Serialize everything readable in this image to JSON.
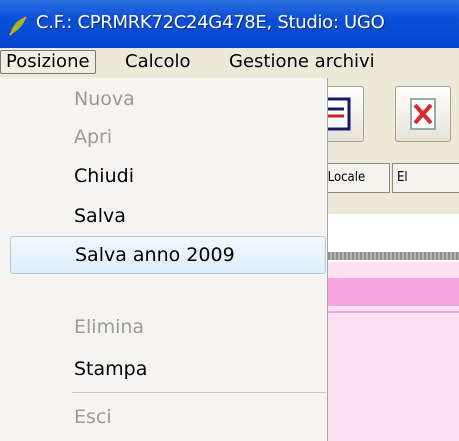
{
  "window": {
    "title": "C.F.: CPRMRK72C24G478E, Studio: UGO"
  },
  "menubar": {
    "items": [
      "Posizione",
      "Calcolo",
      "Gestione archivi"
    ]
  },
  "dropdown": {
    "items": [
      {
        "label": "Nuova",
        "enabled": false
      },
      {
        "label": "Apri",
        "enabled": false
      },
      {
        "label": "Chiudi",
        "enabled": true
      },
      {
        "label": "Salva",
        "enabled": true
      },
      {
        "label": "Salva anno 2009",
        "enabled": true,
        "highlighted": true
      },
      {
        "label": "Elimina",
        "enabled": false
      },
      {
        "label": "Stampa",
        "enabled": true
      },
      {
        "label": "Esci",
        "enabled": false
      }
    ]
  },
  "tabs": [
    "ta' Locale",
    "El"
  ],
  "colors": {
    "titlebar": "#0a4fd6",
    "highlight": "#ddeefa",
    "pink": "#fde0f2",
    "pink_band": "#f7a6e0"
  }
}
